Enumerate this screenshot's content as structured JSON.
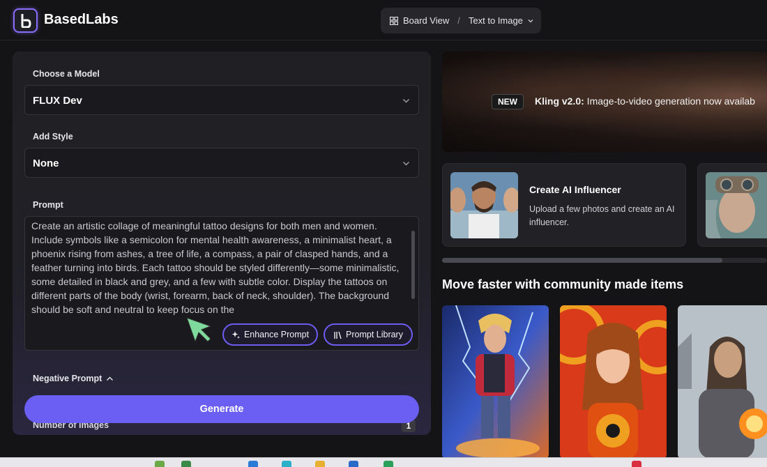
{
  "header": {
    "brand": "BasedLabs",
    "nav": {
      "board_view": "Board View",
      "separator": "/",
      "current": "Text to Image"
    }
  },
  "form": {
    "model_label": "Choose a Model",
    "model_value": "FLUX Dev",
    "style_label": "Add Style",
    "style_value": "None",
    "prompt_label": "Prompt",
    "prompt_value": "Create an artistic collage of meaningful tattoo designs for both men and women. Include symbols like a semicolon for mental health awareness, a minimalist heart, a phoenix rising from ashes, a tree of life, a compass, a pair of clasped hands, and a feather turning into birds. Each tattoo should be styled differently—some minimalistic, some detailed in black and grey, and a few with subtle color. Display the tattoos on different parts of the body (wrist, forearm, back of neck, shoulder). The background should be soft and neutral to keep focus on the",
    "enhance_label": "Enhance Prompt",
    "library_label": "Prompt Library",
    "negative_label": "Negative Prompt",
    "generate_label": "Generate",
    "num_images_label": "Number of Images",
    "num_images_value": "1"
  },
  "banner": {
    "badge": "NEW",
    "title": "Kling v2.0:",
    "text": " Image-to-video generation now availab"
  },
  "cards": [
    {
      "title": "Create AI Influencer",
      "description": "Upload a few photos and create an AI influencer."
    }
  ],
  "community": {
    "title": "Move faster with community made items"
  },
  "colors": {
    "accent": "#6a5ff2",
    "panel": "#202024",
    "background": "#141416"
  }
}
